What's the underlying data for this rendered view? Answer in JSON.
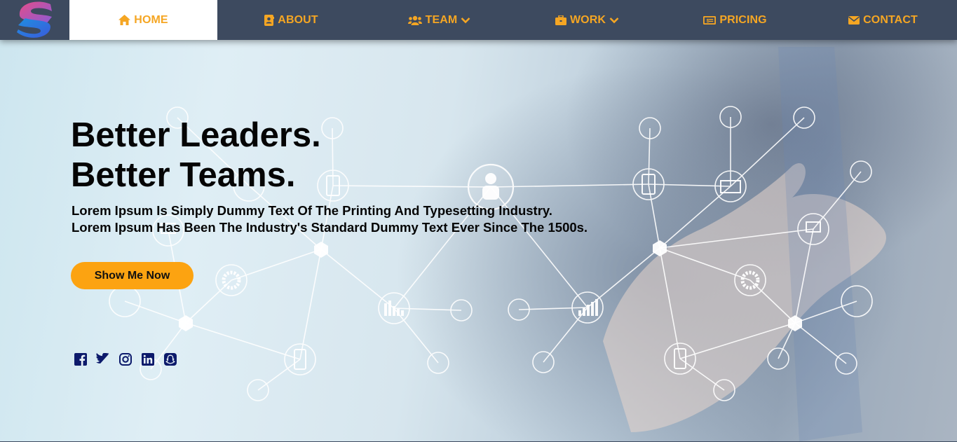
{
  "nav": {
    "items": [
      {
        "label": "HOME",
        "icon": "home-icon",
        "active": true
      },
      {
        "label": "ABOUT",
        "icon": "address-card-icon",
        "active": false
      },
      {
        "label": "TEAM",
        "icon": "users-icon",
        "active": false,
        "dropdown": true
      },
      {
        "label": "WORK",
        "icon": "briefcase-icon",
        "active": false,
        "dropdown": true
      },
      {
        "label": "PRICING",
        "icon": "money-bill-icon",
        "active": false
      },
      {
        "label": "CONTACT",
        "icon": "envelope-icon",
        "active": false
      }
    ]
  },
  "hero": {
    "title_line1": "Better Leaders.",
    "title_line2": "Better Teams.",
    "subtitle_line1": "Lorem Ipsum Is Simply Dummy Text Of The Printing And Typesetting Industry.",
    "subtitle_line2": "Lorem Ipsum Has Been The Industry's Standard Dummy Text Ever Since The 1500s.",
    "cta_label": "Show Me Now"
  },
  "socials": [
    "facebook-icon",
    "twitter-icon",
    "instagram-icon",
    "linkedin-icon",
    "snapchat-icon"
  ],
  "colors": {
    "navbar_bg": "#3d4a5f",
    "accent": "#f5a623",
    "cta_bg": "#fca311",
    "social_icons": "#0c1a6b"
  }
}
